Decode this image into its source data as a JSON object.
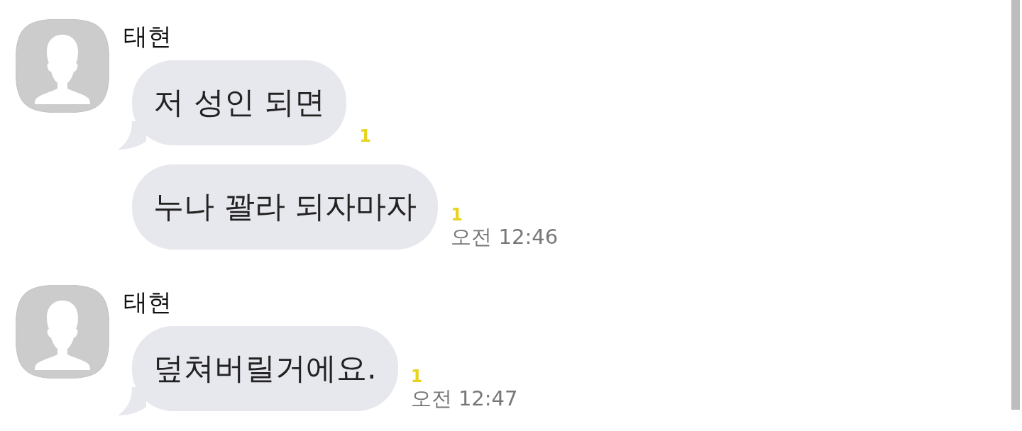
{
  "groups": [
    {
      "sender": "태현",
      "messages": [
        {
          "text": "저 성인 되면",
          "unread": "1"
        },
        {
          "text": "누나 꽐라 되자마자",
          "unread": "1",
          "time": "오전 12:46"
        }
      ]
    },
    {
      "sender": "태현",
      "messages": [
        {
          "text": "덮쳐버릴거에요.",
          "unread": "1",
          "time": "오전 12:47"
        }
      ]
    }
  ]
}
